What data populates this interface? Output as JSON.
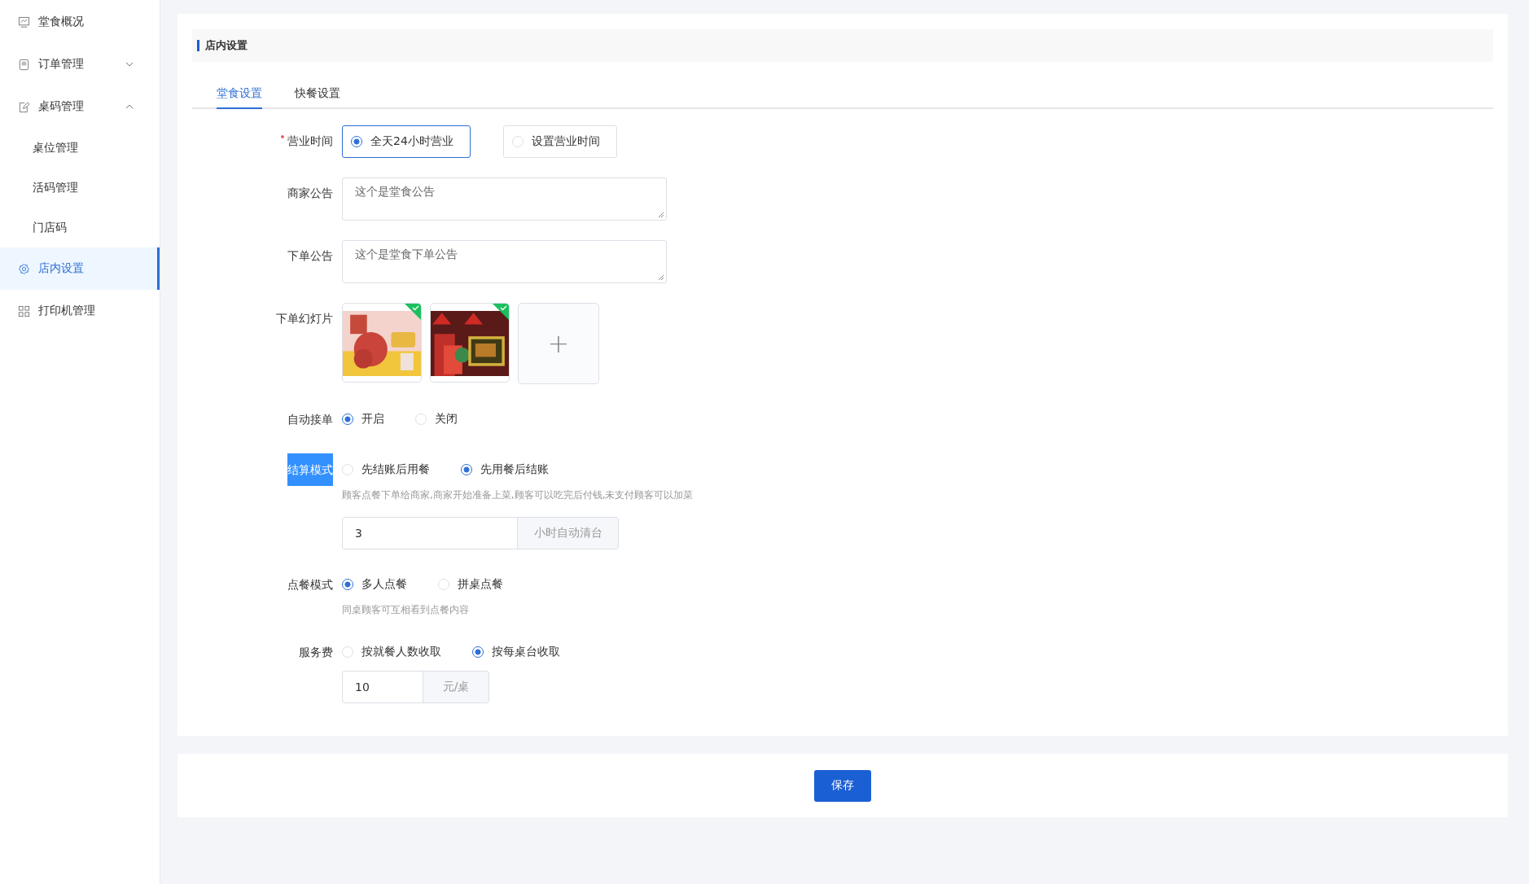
{
  "sidebar": {
    "items": [
      {
        "label": "堂食概况",
        "selected": false
      },
      {
        "label": "订单管理",
        "selected": false,
        "expanded": false
      },
      {
        "label": "桌码管理",
        "selected": false,
        "expanded": true,
        "children": [
          {
            "label": "桌位管理",
            "selected": false
          },
          {
            "label": "活码管理",
            "selected": false
          },
          {
            "label": "门店码",
            "selected": false
          }
        ]
      },
      {
        "label": "店内设置",
        "selected": true
      },
      {
        "label": "打印机管理",
        "selected": false
      }
    ]
  },
  "section_title": "店内设置",
  "tabs": [
    {
      "label": "堂食设置",
      "selected": true
    },
    {
      "label": "快餐设置",
      "selected": false
    }
  ],
  "form": {
    "fields": [
      {
        "kind": "radio",
        "label": "营业时间",
        "required": true,
        "highlighted": false,
        "boxed": true,
        "options": [
          {
            "label": "全天24小时营业",
            "selected": true
          },
          {
            "label": "设置营业时间",
            "selected": false
          }
        ]
      },
      {
        "kind": "textarea",
        "label": "商家公告",
        "required": false,
        "highlighted": false,
        "value": "这个是堂食公告"
      },
      {
        "kind": "textarea",
        "label": "下单公告",
        "required": false,
        "highlighted": false,
        "value": "这个是堂食下单公告"
      },
      {
        "kind": "images",
        "label": "下单幻灯片",
        "required": false,
        "highlighted": false,
        "images": [
          {
            "uploaded": true
          },
          {
            "uploaded": true
          }
        ],
        "add_label": "+"
      },
      {
        "kind": "radio",
        "label": "自动接单",
        "required": false,
        "highlighted": false,
        "boxed": false,
        "options": [
          {
            "label": "开启",
            "selected": true
          },
          {
            "label": "关闭",
            "selected": false
          }
        ]
      },
      {
        "kind": "radio",
        "label": "结算模式",
        "required": false,
        "highlighted": true,
        "boxed": false,
        "options": [
          {
            "label": "先结账后用餐",
            "selected": false
          },
          {
            "label": "先用餐后结账",
            "selected": true
          }
        ],
        "hint": "顾客点餐下单给商家,商家开始准备上菜,顾客可以吃完后付钱,未支付顾客可以加菜",
        "input": {
          "value": "3",
          "suffix": "小时自动清台"
        }
      },
      {
        "kind": "radio",
        "label": "点餐模式",
        "required": false,
        "highlighted": false,
        "boxed": false,
        "options": [
          {
            "label": "多人点餐",
            "selected": true
          },
          {
            "label": "拼桌点餐",
            "selected": false
          }
        ],
        "hint": "同桌顾客可互相看到点餐内容"
      },
      {
        "kind": "radio",
        "label": "服务费",
        "required": false,
        "highlighted": false,
        "boxed": false,
        "options": [
          {
            "label": "按就餐人数收取",
            "selected": false
          },
          {
            "label": "按每桌台收取",
            "selected": true
          }
        ],
        "input": {
          "value": "10",
          "suffix": "元/桌"
        }
      }
    ]
  },
  "save_button": "保存"
}
